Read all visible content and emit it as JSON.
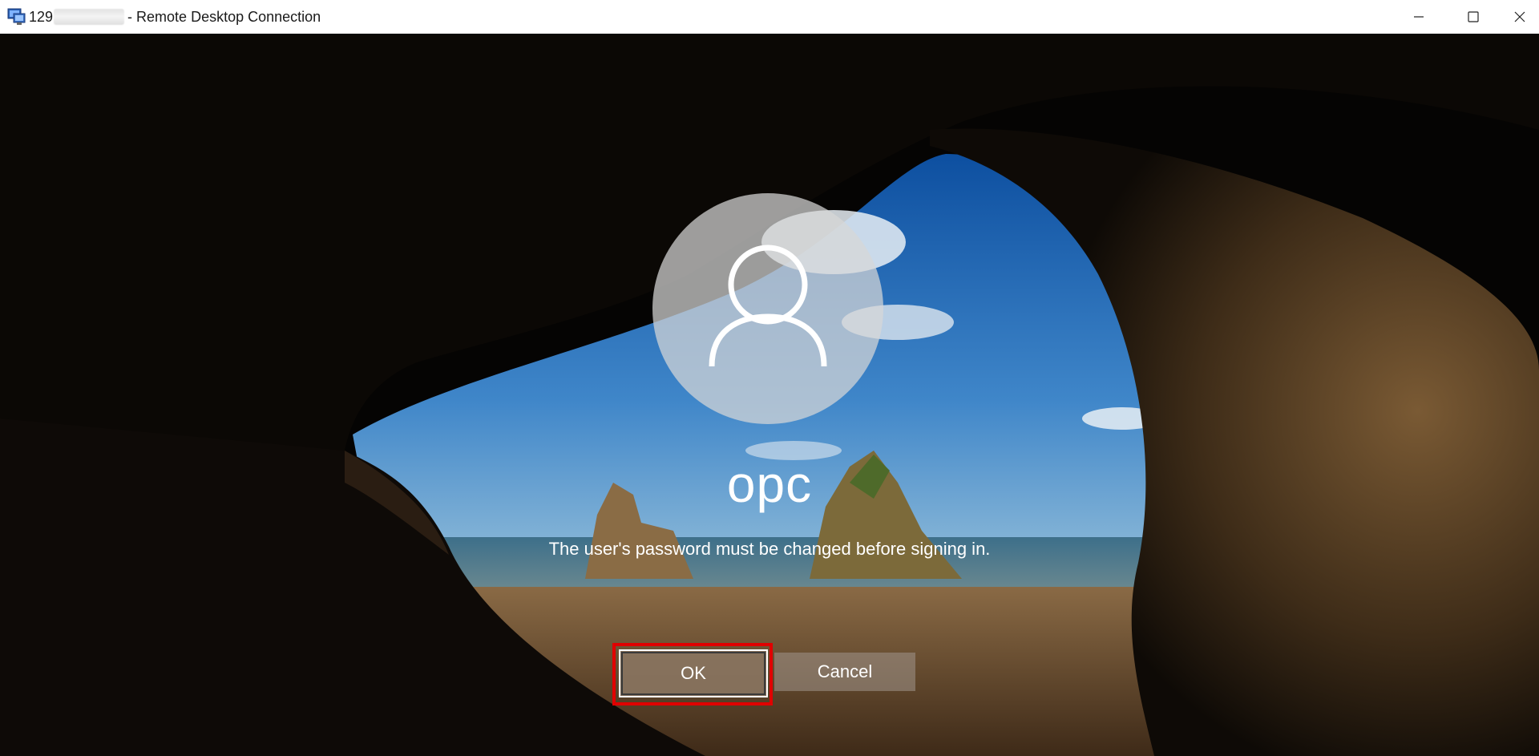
{
  "window": {
    "title_prefix": "129",
    "title_suffix": "- Remote Desktop Connection"
  },
  "login": {
    "username": "opc",
    "message": "The user's password must be changed before signing in.",
    "ok_label": "OK",
    "cancel_label": "Cancel"
  },
  "icons": {
    "app": "remote-desktop-icon",
    "avatar": "user-icon",
    "minimize": "minimize-icon",
    "maximize": "maximize-icon",
    "close": "close-icon"
  },
  "colors": {
    "highlight": "#e00000",
    "titlebar": "#ffffff",
    "button_ok": "#8c7864",
    "button_cancel": "#a0968c"
  }
}
